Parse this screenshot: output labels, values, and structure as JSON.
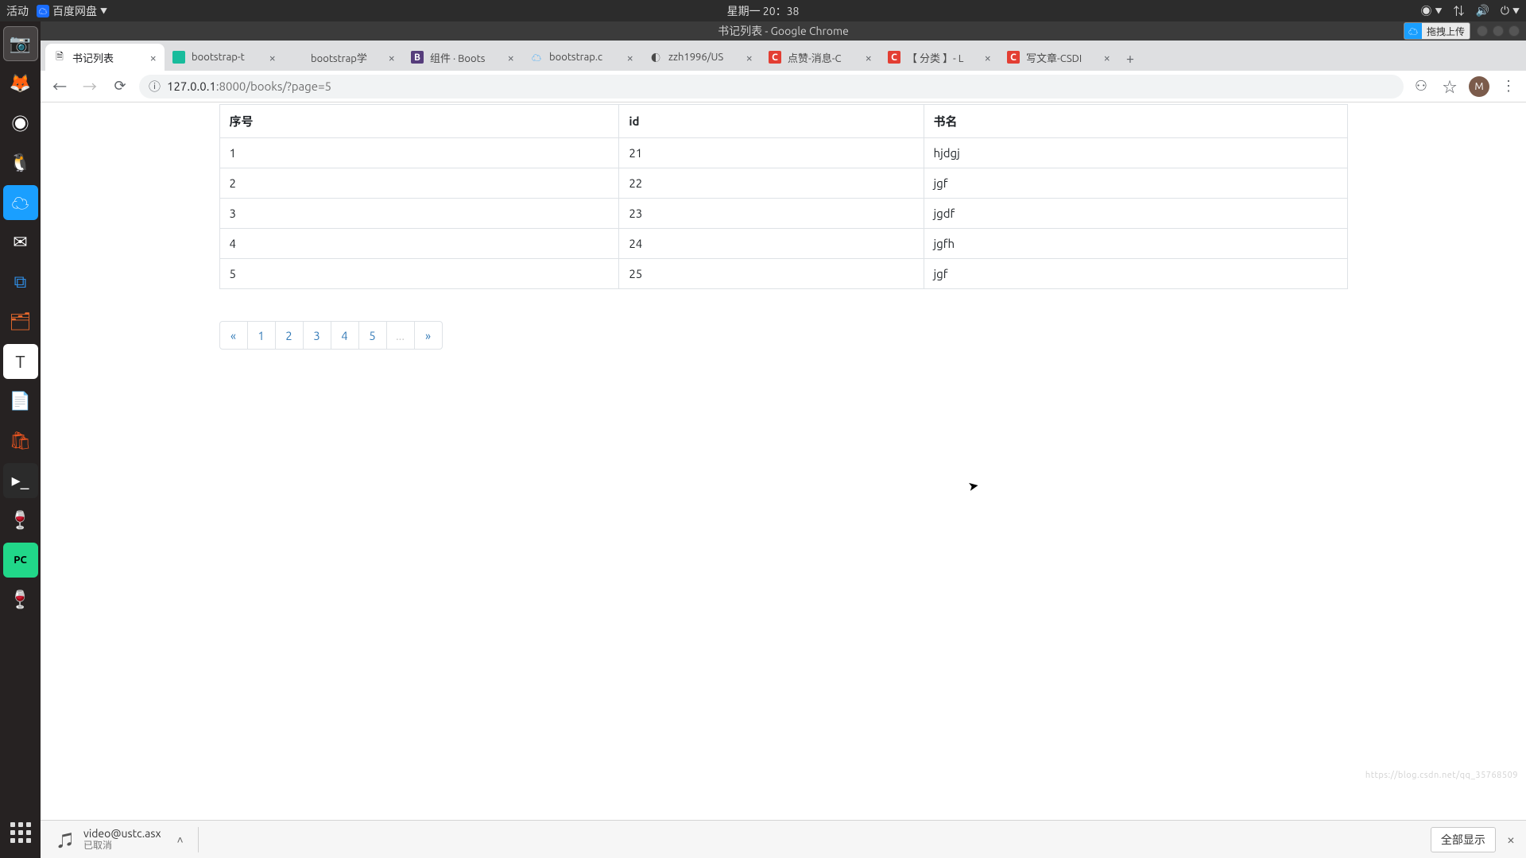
{
  "panel": {
    "activities": "活动",
    "app_indicator": "百度网盘",
    "clock": "星期一 20：38"
  },
  "float": {
    "label": "拖拽上传"
  },
  "chrome_window_title": "书记列表 - Google Chrome",
  "tabs": [
    {
      "title": "书记列表",
      "fav": "page"
    },
    {
      "title": "bootstrap-t",
      "fav": "bs-teal"
    },
    {
      "title": "bootstrap学",
      "fav": "blank"
    },
    {
      "title": "组件 · Boots",
      "fav": "B"
    },
    {
      "title": "bootstrap.c",
      "fav": "cloud"
    },
    {
      "title": "zzh1996/US",
      "fav": "gh"
    },
    {
      "title": "点赞-消息-C",
      "fav": "C"
    },
    {
      "title": "【 分类 】- L",
      "fav": "C"
    },
    {
      "title": "写文章-CSDI",
      "fav": "C"
    }
  ],
  "url": {
    "host": "127.0.0.1",
    "port": ":8000",
    "path": "/books/?page=5"
  },
  "avatar_letter": "M",
  "table": {
    "headers": {
      "seq": "序号",
      "id": "id",
      "name": "书名"
    },
    "rows": [
      {
        "seq": "1",
        "id": "21",
        "name": "hjdgj"
      },
      {
        "seq": "2",
        "id": "22",
        "name": "jgf"
      },
      {
        "seq": "3",
        "id": "23",
        "name": "jgdf"
      },
      {
        "seq": "4",
        "id": "24",
        "name": "jgfh"
      },
      {
        "seq": "5",
        "id": "25",
        "name": "jgf"
      }
    ]
  },
  "pagination": {
    "prev": "«",
    "pages": [
      "1",
      "2",
      "3",
      "4",
      "5"
    ],
    "ellipsis": "...",
    "next": "»"
  },
  "download": {
    "filename": "video@ustc.asx",
    "status": "已取消",
    "show_all": "全部显示"
  },
  "watermark": "https://blog.csdn.net/qq_35768509"
}
